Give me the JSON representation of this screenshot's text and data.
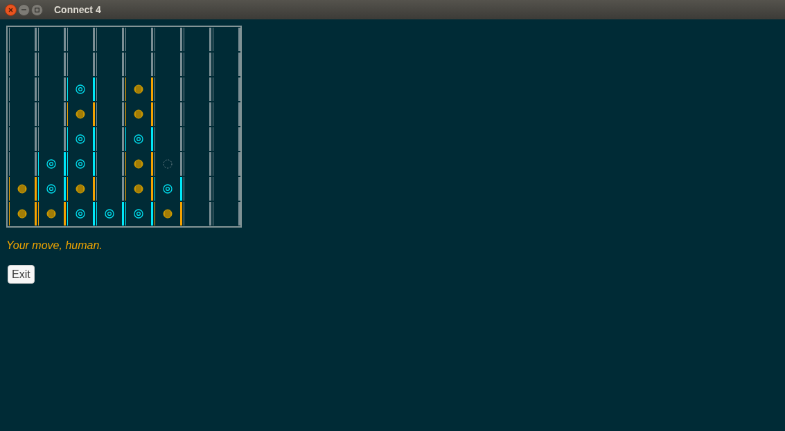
{
  "window": {
    "title": "Connect 4"
  },
  "board": {
    "rows": [
      [
        {
          "kind": "empty"
        },
        {
          "kind": "empty"
        },
        {
          "kind": "empty"
        },
        {
          "kind": "empty"
        },
        {
          "kind": "empty"
        },
        {
          "kind": "empty"
        },
        {
          "kind": "empty"
        },
        {
          "kind": "empty"
        }
      ],
      [
        {
          "kind": "empty"
        },
        {
          "kind": "empty"
        },
        {
          "kind": "empty"
        },
        {
          "kind": "empty"
        },
        {
          "kind": "empty"
        },
        {
          "kind": "empty"
        },
        {
          "kind": "empty"
        },
        {
          "kind": "empty"
        }
      ],
      [
        {
          "kind": "empty"
        },
        {
          "kind": "empty"
        },
        {
          "kind": "ring"
        },
        {
          "kind": "empty"
        },
        {
          "kind": "disc"
        },
        {
          "kind": "empty"
        },
        {
          "kind": "empty"
        },
        {
          "kind": "empty"
        }
      ],
      [
        {
          "kind": "empty"
        },
        {
          "kind": "empty"
        },
        {
          "kind": "disc"
        },
        {
          "kind": "empty"
        },
        {
          "kind": "disc"
        },
        {
          "kind": "empty"
        },
        {
          "kind": "empty"
        },
        {
          "kind": "empty"
        }
      ],
      [
        {
          "kind": "empty"
        },
        {
          "kind": "empty"
        },
        {
          "kind": "ring"
        },
        {
          "kind": "empty"
        },
        {
          "kind": "ring"
        },
        {
          "kind": "empty"
        },
        {
          "kind": "empty"
        },
        {
          "kind": "empty"
        }
      ],
      [
        {
          "kind": "empty"
        },
        {
          "kind": "ring"
        },
        {
          "kind": "ring"
        },
        {
          "kind": "empty"
        },
        {
          "kind": "disc"
        },
        {
          "kind": "ghost"
        },
        {
          "kind": "empty"
        },
        {
          "kind": "empty"
        }
      ],
      [
        {
          "kind": "disc"
        },
        {
          "kind": "ring"
        },
        {
          "kind": "disc"
        },
        {
          "kind": "empty"
        },
        {
          "kind": "disc"
        },
        {
          "kind": "ring"
        },
        {
          "kind": "empty"
        },
        {
          "kind": "empty"
        }
      ],
      [
        {
          "kind": "disc"
        },
        {
          "kind": "disc"
        },
        {
          "kind": "ring"
        },
        {
          "kind": "ring"
        },
        {
          "kind": "ring"
        },
        {
          "kind": "disc"
        },
        {
          "kind": "empty"
        },
        {
          "kind": "empty"
        }
      ]
    ]
  },
  "status": "Your move, human.",
  "buttons": [
    {
      "label": "Exit"
    }
  ]
}
